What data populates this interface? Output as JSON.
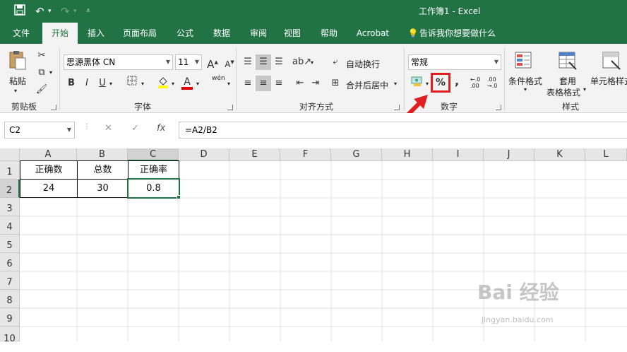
{
  "app": {
    "title": "工作簿1  -  Excel"
  },
  "quick_access": {
    "save_icon": "save-icon",
    "undo_icon": "undo-icon",
    "redo_icon": "redo-icon",
    "more_icon": "customize-icon"
  },
  "tabs": [
    "文件",
    "开始",
    "插入",
    "页面布局",
    "公式",
    "数据",
    "审阅",
    "视图",
    "帮助",
    "Acrobat",
    "告诉我你想要做什么"
  ],
  "ribbon": {
    "clipboard": {
      "paste_label": "粘贴",
      "group_label": "剪贴板"
    },
    "font": {
      "font_name": "思源黑体 CN",
      "font_size": "11",
      "grow_label": "A",
      "shrink_label": "A",
      "bold": "B",
      "italic": "I",
      "underline": "U",
      "font_color_label": "A",
      "phonetic_label": "wén",
      "group_label": "字体"
    },
    "alignment": {
      "wrap_label": "自动换行",
      "merge_label": "合并后居中",
      "group_label": "对齐方式"
    },
    "number": {
      "format": "常规",
      "percent_label": "%",
      "comma_label": ",",
      "inc_decimal_label": "←.0 .00",
      "dec_decimal_label": ".00 →.0",
      "group_label": "数字"
    },
    "styles": {
      "conditional_label": "条件格式",
      "table_label_1": "套用",
      "table_label_2": "表格格式",
      "cell_styles_label": "单元格样式",
      "group_label": "样式"
    }
  },
  "formula_bar": {
    "name_box": "C2",
    "cancel": "✕",
    "enter": "✓",
    "fx": "fx",
    "formula": "=A2/B2"
  },
  "sheet": {
    "columns": [
      "A",
      "B",
      "C",
      "D",
      "E",
      "F",
      "G",
      "H",
      "I",
      "J",
      "K",
      "L"
    ],
    "rows": [
      "1",
      "2",
      "3",
      "4",
      "5",
      "6",
      "7",
      "8",
      "9",
      "10"
    ],
    "cells": {
      "A1": "正确数",
      "B1": "总数",
      "C1": "正确率",
      "A2": "24",
      "B2": "30",
      "C2": "0.8"
    },
    "selected_cell": "C2"
  },
  "watermark": {
    "brand": "Bai 经验",
    "url": "jingyan.baidu.com"
  }
}
